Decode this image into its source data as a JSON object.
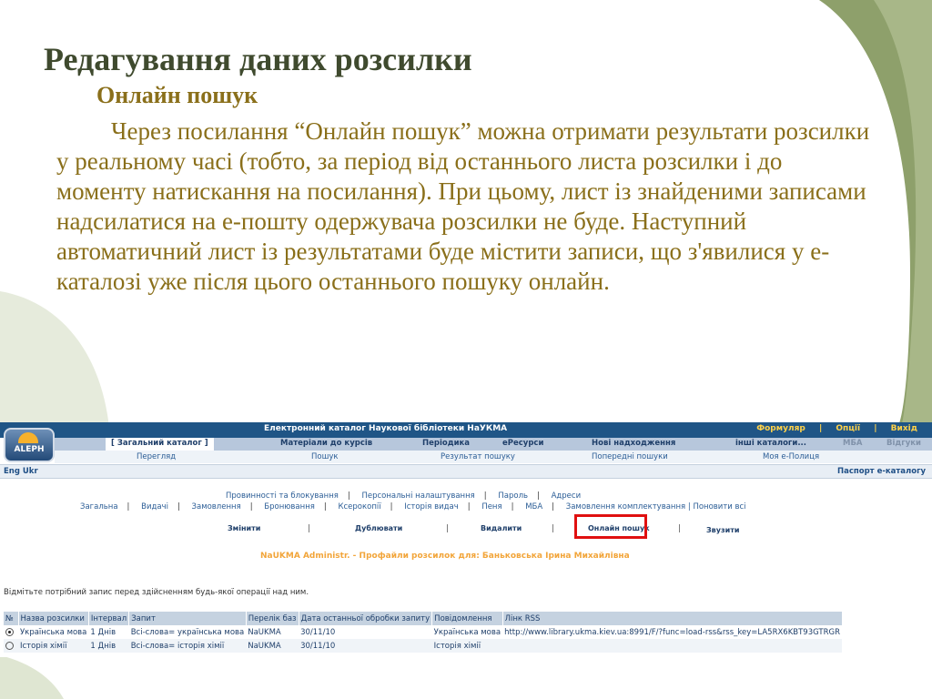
{
  "slide": {
    "title": "Редагування даних розсилки",
    "subtitle": "Онлайн пошук",
    "body": "Через посилання “Онлайн пошук” можна отримати результати розсилки у реальному часі (тобто, за період від останнього листа розсилки і до моменту натискання на посилання). При цьому, лист із знайденими записами надсилатися на е-пошту одержувача розсилки не буде. Наступний автоматичний лист із результатами буде містити записи, що з'явилися у е-каталозі уже після цього останнього пошуку онлайн."
  },
  "colors": {
    "title": "#3f4a2e",
    "text": "#8a6f1a",
    "header_bar": "#1f5586",
    "accent": "#f2a53a",
    "highlight": "#e01010"
  },
  "app": {
    "logo": "ALEPH",
    "title": "Електронний каталог Наукової бібліотеки НаУКМА",
    "top_links": [
      "Формуляр",
      "|",
      "Опції",
      "|",
      "Вихід"
    ],
    "tabs": [
      "[ Загальний каталог ]",
      "Матеріали до курсів",
      "Періодика",
      "еРесурси",
      "Нові надходження",
      "інші каталоги...",
      "МБА",
      "Відгуки"
    ],
    "subnav": [
      "Перегляд",
      "Пошук",
      "Результат пошуку",
      "Попередні пошуки",
      "Моя е-Полиця"
    ],
    "lang": "Eng Ukr",
    "passport": "Паспорт е-каталогу",
    "menu_row1": [
      "Провинності та блокування",
      "Персональні налаштування",
      "Пароль",
      "Адреси"
    ],
    "menu_row2": [
      "Загальна",
      "Видачі",
      "Замовлення",
      "Бронювання",
      "Ксерокопії",
      "Історія видач",
      "Пеня",
      "МБА",
      "Замовлення комплектування",
      "Поновити всі"
    ],
    "actions": [
      "Змінити",
      "Дублювати",
      "Видалити",
      "Онлайн пошук",
      "Звузити"
    ],
    "profile_heading": "NaUKMA Administr. - Профайли розсилок для: Баньковська Ірина Михайлівна",
    "instruction": "Відмітьте потрібний запис перед здійсненням будь-якої операції над ним.",
    "table": {
      "headers": [
        "№",
        "Назва розсилки",
        "Інтервал",
        "Запит",
        "Перелік баз",
        "Дата останньої обробки запиту",
        "Повідомлення",
        "Лінк RSS"
      ],
      "rows": [
        {
          "name": "Українська мова",
          "interval": "1 Днів",
          "query": "Всі-слова= українська мова",
          "base": "NaUKMA",
          "date": "30/11/10",
          "message": "Українська мова",
          "rss": "http://www.library.ukma.kiev.ua:8991/F/?func=load-rss&rss_key=LA5RX6KBT93GTRGR",
          "selected": true
        },
        {
          "name": "Історія хімії",
          "interval": "1 Днів",
          "query": "Всі-слова= історія хімії",
          "base": "NaUKMA",
          "date": "30/11/10",
          "message": "Історія хімії",
          "rss": "",
          "selected": false
        }
      ]
    }
  }
}
